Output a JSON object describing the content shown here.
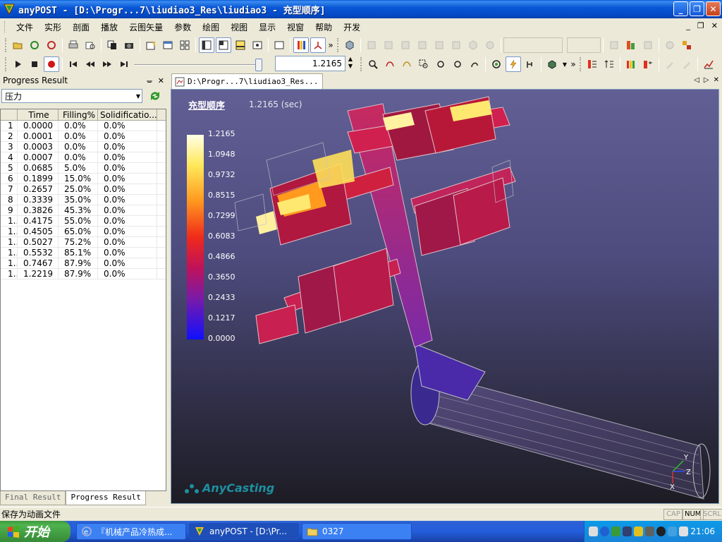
{
  "window": {
    "title": "anyPOST - [D:\\Progr...7\\liudiao3_Res\\liudiao3 - 充型顺序]",
    "minimize_label": "_",
    "restore_label": "❐",
    "close_label": "✕"
  },
  "menu": {
    "items": [
      "文件",
      "实形",
      "剖面",
      "播放",
      "云图矢量",
      "参数",
      "绘图",
      "视图",
      "显示",
      "视窗",
      "帮助",
      "开发"
    ],
    "mdi_minimize": "_",
    "mdi_restore": "❐",
    "mdi_close": "✕"
  },
  "playback": {
    "time_value": "1.2165",
    "slider_fraction": 0.98
  },
  "panel": {
    "title": "Progress Result",
    "pin_label": "ᚚ",
    "close_label": "✕",
    "variable": "压力",
    "columns": [
      "",
      "Time",
      "Filling%",
      "Solidificatio..."
    ],
    "rows": [
      [
        "1",
        "0.0000",
        "0.0%",
        "0.0%"
      ],
      [
        "2",
        "0.0001",
        "0.0%",
        "0.0%"
      ],
      [
        "3",
        "0.0003",
        "0.0%",
        "0.0%"
      ],
      [
        "4",
        "0.0007",
        "0.0%",
        "0.0%"
      ],
      [
        "5",
        "0.0685",
        "5.0%",
        "0.0%"
      ],
      [
        "6",
        "0.1899",
        "15.0%",
        "0.0%"
      ],
      [
        "7",
        "0.2657",
        "25.0%",
        "0.0%"
      ],
      [
        "8",
        "0.3339",
        "35.0%",
        "0.0%"
      ],
      [
        "9",
        "0.3826",
        "45.3%",
        "0.0%"
      ],
      [
        "1..",
        "0.4175",
        "55.0%",
        "0.0%"
      ],
      [
        "1..",
        "0.4505",
        "65.0%",
        "0.0%"
      ],
      [
        "1..",
        "0.5027",
        "75.2%",
        "0.0%"
      ],
      [
        "1..",
        "0.5532",
        "85.1%",
        "0.0%"
      ],
      [
        "1..",
        "0.7467",
        "87.9%",
        "0.0%"
      ],
      [
        "1..",
        "1.2219",
        "87.9%",
        "0.0%"
      ]
    ],
    "tabs": [
      "Final Result",
      "Progress Result"
    ]
  },
  "document": {
    "tab_label": "D:\\Progr...7\\liudiao3_Res...",
    "nav_left": "◁",
    "nav_right": "▷",
    "nav_close": "✕"
  },
  "viewport": {
    "title": "充型顺序",
    "time": "1.2165 (sec)",
    "legend_values": [
      "1.2165",
      "1.0948",
      "0.9732",
      "0.8515",
      "0.7299",
      "0.6083",
      "0.4866",
      "0.3650",
      "0.2433",
      "0.1217",
      "0.0000"
    ],
    "brand": "AnyCasting",
    "axis_x": "X",
    "axis_y": "Y",
    "axis_z": "Z"
  },
  "status": {
    "message": "保存为动画文件",
    "cap": "CAP",
    "num": "NUM",
    "scrl": "SCRL"
  },
  "taskbar": {
    "start_label": "开始",
    "tasks": [
      "『机械产品冷热成...",
      "anyPOST - [D:\\Pr...",
      "0327"
    ],
    "clock": "21:06"
  },
  "colors": {
    "title_blue": "#0a57d6",
    "viewport_top": "#615f94",
    "brand_teal": "#1e8fa0"
  }
}
